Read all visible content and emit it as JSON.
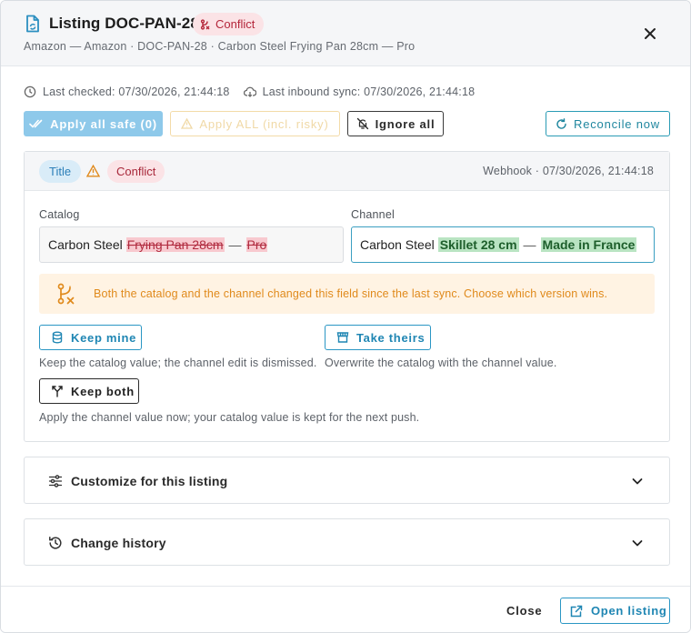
{
  "header": {
    "title": "Listing DOC-PAN-28",
    "status_badge": "Conflict",
    "subtitle": "Amazon — Amazon · DOC-PAN-28 · Carbon Steel Frying Pan 28cm — Pro"
  },
  "sync": {
    "last_checked": "Last checked: 07/30/2026, 21:44:18",
    "last_inbound": "Last inbound sync: 07/30/2026, 21:44:18"
  },
  "toolbar": {
    "apply_safe": "Apply all safe (0)",
    "apply_all": "Apply ALL (incl. risky)",
    "ignore_all": "Ignore all",
    "reconcile": "Reconcile now"
  },
  "conflict": {
    "field_tag": "Title",
    "status_tag": "Conflict",
    "source": "Webhook · 07/30/2026, 21:44:18",
    "catalog_label": "Catalog",
    "channel_label": "Channel",
    "catalog_value": {
      "common": "Carbon Steel",
      "removed_1": "Frying Pan 28cm",
      "dash": "—",
      "removed_2": "Pro"
    },
    "channel_value": {
      "common": "Carbon Steel",
      "added_1": "Skillet 28 cm",
      "dash": "—",
      "added_2": "Made in France"
    },
    "warning": "Both the catalog and the channel changed this field since the last sync. Choose which version wins.",
    "actions": {
      "keep_mine": "Keep mine",
      "keep_mine_hint": "Keep the catalog value; the channel edit is dismissed.",
      "take_theirs": "Take theirs",
      "take_theirs_hint": "Overwrite the catalog with the channel value.",
      "keep_both": "Keep both",
      "keep_both_hint": "Apply the channel value now; your catalog value is kept for the next push."
    }
  },
  "sections": {
    "customize": "Customize for this listing",
    "history": "Change history"
  },
  "footer": {
    "close": "Close",
    "open_listing": "Open listing"
  },
  "colors": {
    "accent": "#1f86b3",
    "conflict": "#b4263a",
    "warning": "#e08a1c"
  },
  "icons": [
    "document-sync-icon",
    "merge-conflict-icon",
    "close-icon",
    "clock-icon",
    "cloud-download-icon",
    "double-check-icon",
    "warning-icon",
    "bell-off-icon",
    "refresh-icon",
    "database-icon",
    "storefront-icon",
    "fork-icon",
    "sliders-icon",
    "history-icon",
    "chevron-down-icon",
    "external-link-icon"
  ]
}
